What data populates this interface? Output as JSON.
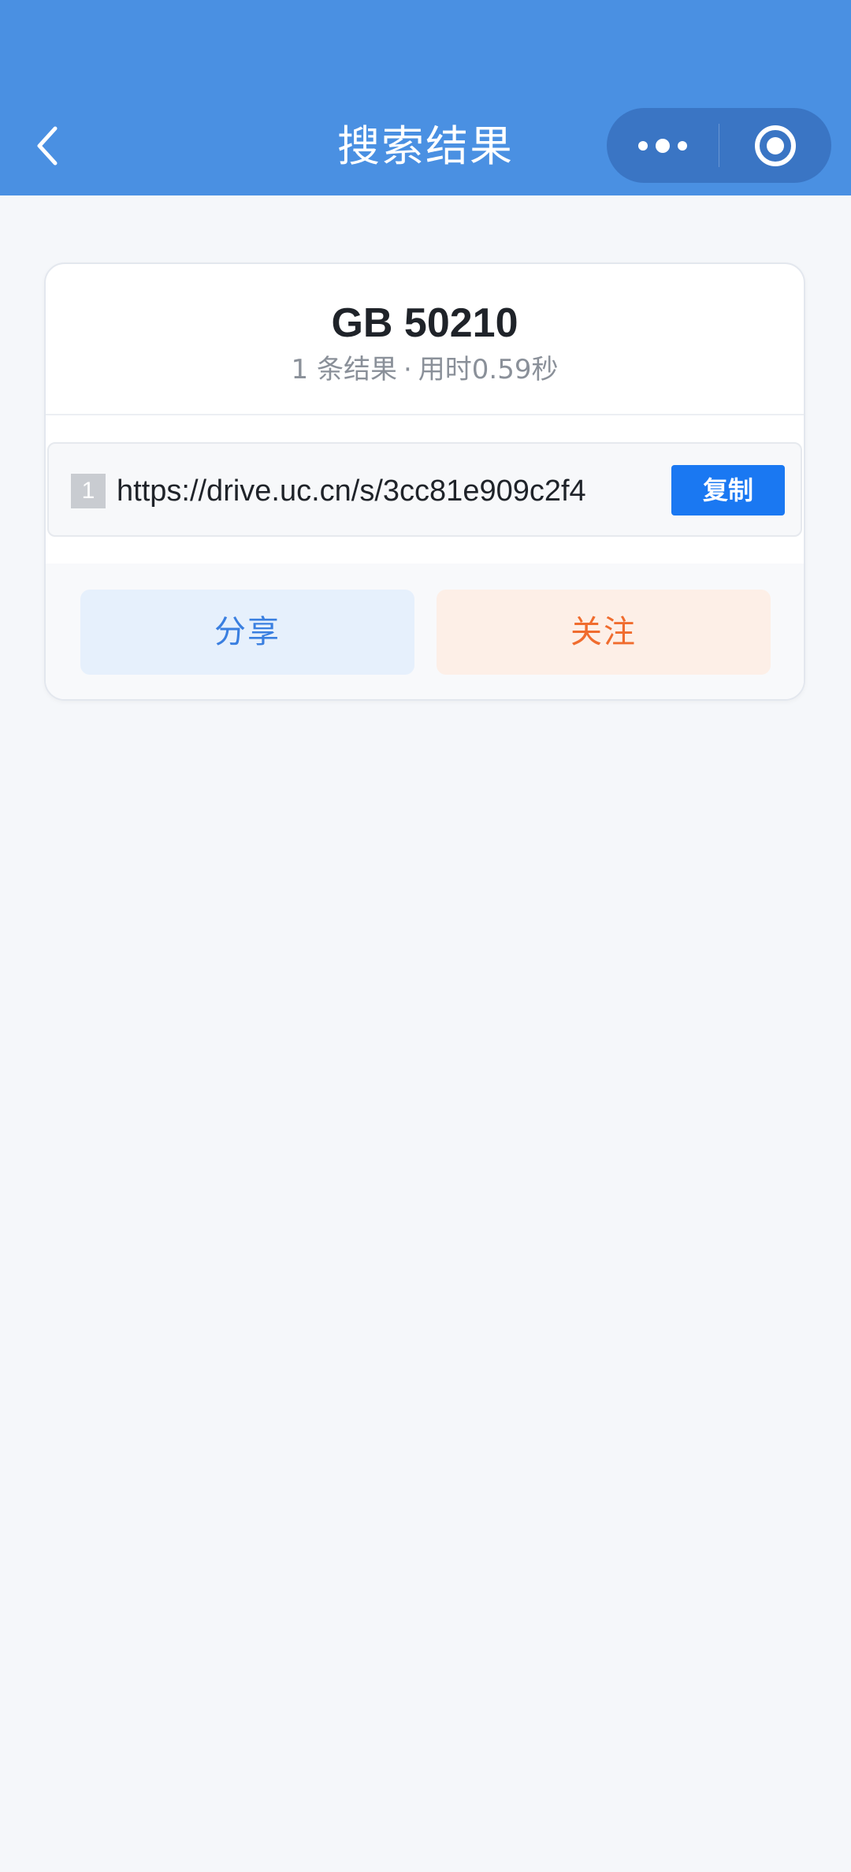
{
  "header": {
    "title": "搜索结果",
    "back_icon": "chevron-left-icon",
    "more_icon": "more-dots-icon",
    "close_icon": "target-circle-icon",
    "background_color": "#4a90e2"
  },
  "card": {
    "query": "GB 50210",
    "result_count": "1 条结果",
    "separator": "·",
    "elapsed": "用时0.59秒",
    "results": [
      {
        "index": "1",
        "link": "https://drive.uc.cn/s/3cc81e909c2f4",
        "copy_label": "复制"
      }
    ]
  },
  "actions": {
    "share_label": "分享",
    "follow_label": "关注",
    "share_color": "#3a7fe0",
    "follow_color": "#f06c2e"
  },
  "colors": {
    "primary": "#1a78f2",
    "page_background": "#f5f7fa"
  }
}
